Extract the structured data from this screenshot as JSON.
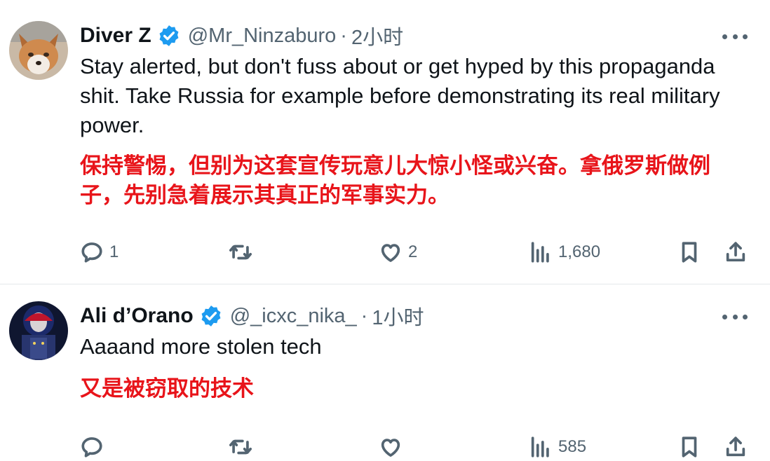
{
  "tweets": [
    {
      "author_name": "Diver Z",
      "handle": "@Mr_Ninzaburo",
      "separator": "·",
      "time": "2小时",
      "text_en": "Stay alerted, but don't fuss about or get hyped by this propaganda shit. Take Russia for example before demonstrating its real military power.",
      "text_zh": "保持警惕，但别为这套宣传玩意儿大惊小怪或兴奋。拿俄罗斯做例子，先别急着展示其真正的军事实力。",
      "replies": "1",
      "retweets": "",
      "likes": "2",
      "views": "1,680",
      "verified": true
    },
    {
      "author_name": "Ali d’Orano",
      "handle": "@_icxc_nika_",
      "separator": "·",
      "time": "1小时",
      "text_en": "Aaaand more stolen tech",
      "text_zh": "又是被窃取的技术",
      "replies": "",
      "retweets": "",
      "likes": "",
      "views": "585",
      "verified": true
    }
  ],
  "colors": {
    "verified_blue": "#1d9bf0",
    "translation_red": "#e8141a",
    "secondary_text": "#536471"
  }
}
